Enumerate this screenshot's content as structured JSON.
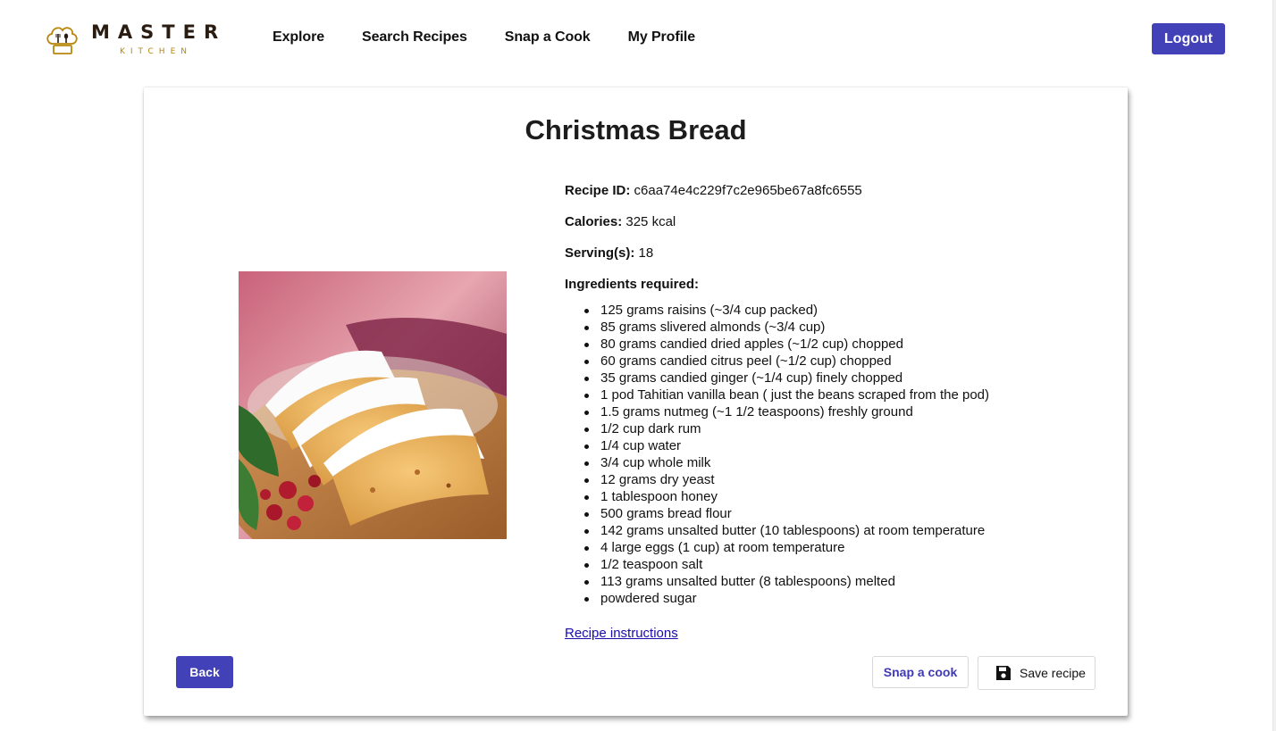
{
  "header": {
    "logo": {
      "title": "MASTER",
      "subtitle": "KITCHEN"
    },
    "nav": [
      "Explore",
      "Search Recipes",
      "Snap a Cook",
      "My Profile"
    ],
    "logout_label": "Logout"
  },
  "recipe": {
    "title": "Christmas Bread",
    "id_label": "Recipe ID:",
    "id_value": "c6aa74e4c229f7c2e965be67a8fc6555",
    "calories_label": "Calories:",
    "calories_value": "325 kcal",
    "servings_label": "Serving(s):",
    "servings_value": "18",
    "ingredients_label": "Ingredients required:",
    "ingredients": [
      "125 grams raisins (~3/4 cup packed)",
      "85 grams slivered almonds (~3/4 cup)",
      "80 grams candied dried apples (~1/2 cup) chopped",
      "60 grams candied citrus peel (~1/2 cup) chopped",
      "35 grams candied ginger (~1/4 cup) finely chopped",
      "1 pod Tahitian vanilla bean ( just the beans scraped from the pod)",
      "1.5 grams nutmeg (~1 1/2 teaspoons) freshly ground",
      "1/2 cup dark rum",
      "1/4 cup water",
      "3/4 cup whole milk",
      "12 grams dry yeast",
      "1 tablespoon honey",
      "500 grams bread flour",
      "142 grams unsalted butter (10 tablespoons) at room temperature",
      "4 large eggs (1 cup) at room temperature",
      "1/2 teaspoon salt",
      "113 grams unsalted butter (8 tablespoons) melted",
      "powdered sugar"
    ],
    "instructions_link": "Recipe instructions"
  },
  "actions": {
    "back_label": "Back",
    "snap_label": "Snap a cook",
    "save_label": "Save recipe"
  },
  "colors": {
    "accent": "#4241b8",
    "link": "#1a0dab",
    "logo_gold": "#b8860b"
  }
}
